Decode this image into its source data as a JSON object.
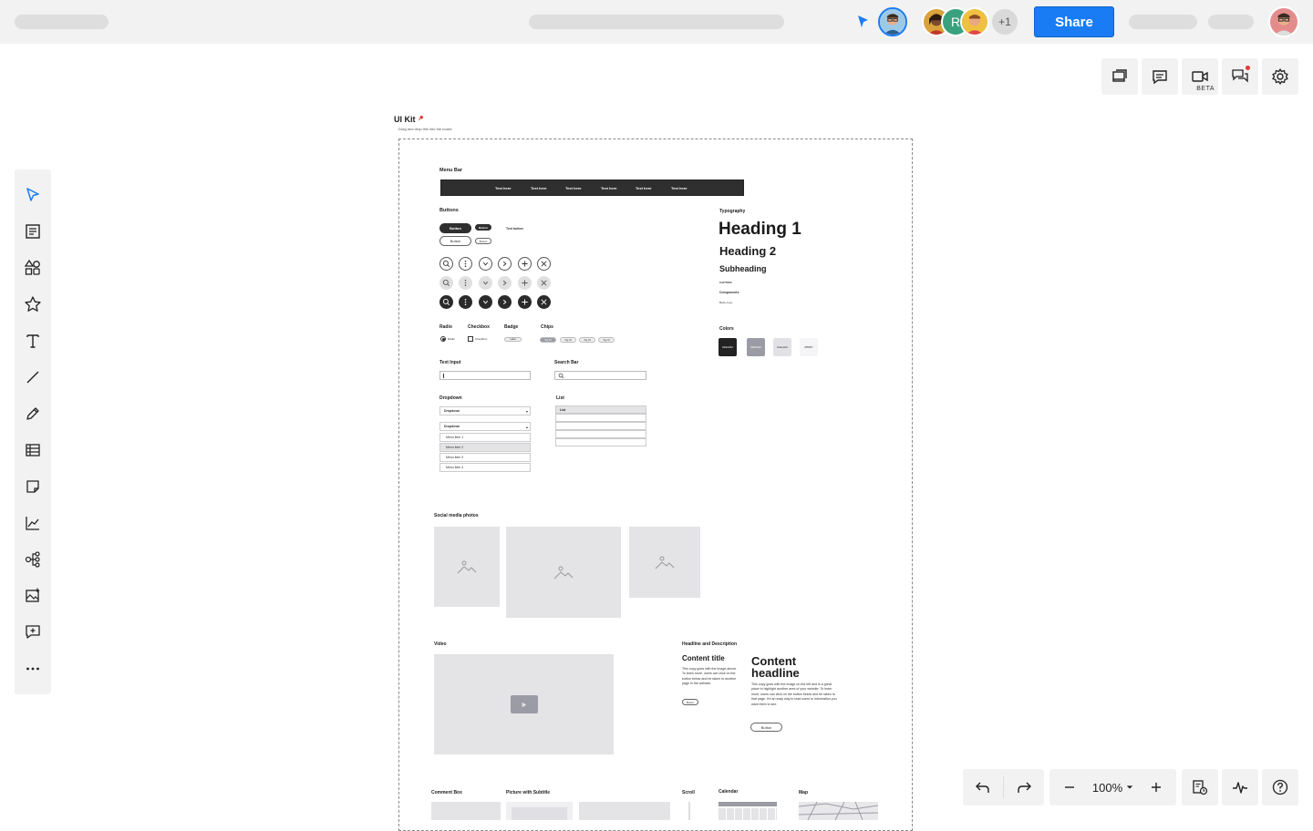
{
  "topbar": {
    "share_label": "Share",
    "extra_collaborators": "+1",
    "collaborator_initial": "R"
  },
  "right_toolbar": {
    "beta_label": "BETA"
  },
  "bottom_toolbar": {
    "zoom_level": "100%"
  },
  "frame": {
    "title": "UI Kit",
    "subtitle": "Drag and drop this into the board",
    "menu_bar_label": "Menu Bar",
    "menu_items": [
      "Text here",
      "Text here",
      "Text here",
      "Text here",
      "Text here",
      "Text here"
    ],
    "buttons_label": "Buttons",
    "button_text": "Button",
    "text_button": "Text button",
    "typography_label": "Typography",
    "heading1": "Heading 1",
    "heading2": "Heading 2",
    "subheading": "Subheading",
    "caption": "CAPTION",
    "components": "Components",
    "body_copy": "Body copy",
    "colors_label": "Colors",
    "colors": [
      {
        "hex": "#222222",
        "label": "#222222"
      },
      {
        "hex": "#9b9ba6",
        "label": "#9b9ba6"
      },
      {
        "hex": "#e2e2e6",
        "label": "#e2e2e6"
      },
      {
        "hex": "#f5f5f7",
        "label": "#f5f5f7"
      }
    ],
    "radio_label": "Radio",
    "radio_text": "Radio",
    "checkbox_label": "Checkbox",
    "checkbox_text": "Checkbox",
    "badge_label": "Badge",
    "badge_text": "Label",
    "chips_label": "Chips",
    "chips": [
      "Tag 01",
      "Tag 02",
      "Tag 03",
      "Tag 04"
    ],
    "text_input_label": "Text Input",
    "search_bar_label": "Search Bar",
    "dropdown_label": "Dropdown",
    "dropdown_text": "Dropdown",
    "menu_items_dd": [
      "Menu item 1",
      "Menu item 2",
      "Menu item 3",
      "Menu item 4"
    ],
    "list_label": "List",
    "list_header": "List",
    "social_label": "Social media photos",
    "video_label": "Video",
    "headline_label": "Headline and Description",
    "content_title": "Content title",
    "content_copy": "This copy goes with the image above. To learn more, users can click on the button below and be taken to another page in the website.",
    "content_headline": "Content headline",
    "content_copy_2": "This copy goes with the image on the left and is a great place to highlight another area of your website. To learn more, users can click on the button below and be taken to that page. It's an easy way to lead users to information you want them to see.",
    "comment_box_label": "Comment Box",
    "picture_subtitle_label": "Picture with Subtitle",
    "scroll_label": "Scroll",
    "calendar_label": "Calendar",
    "map_label": "Map"
  }
}
